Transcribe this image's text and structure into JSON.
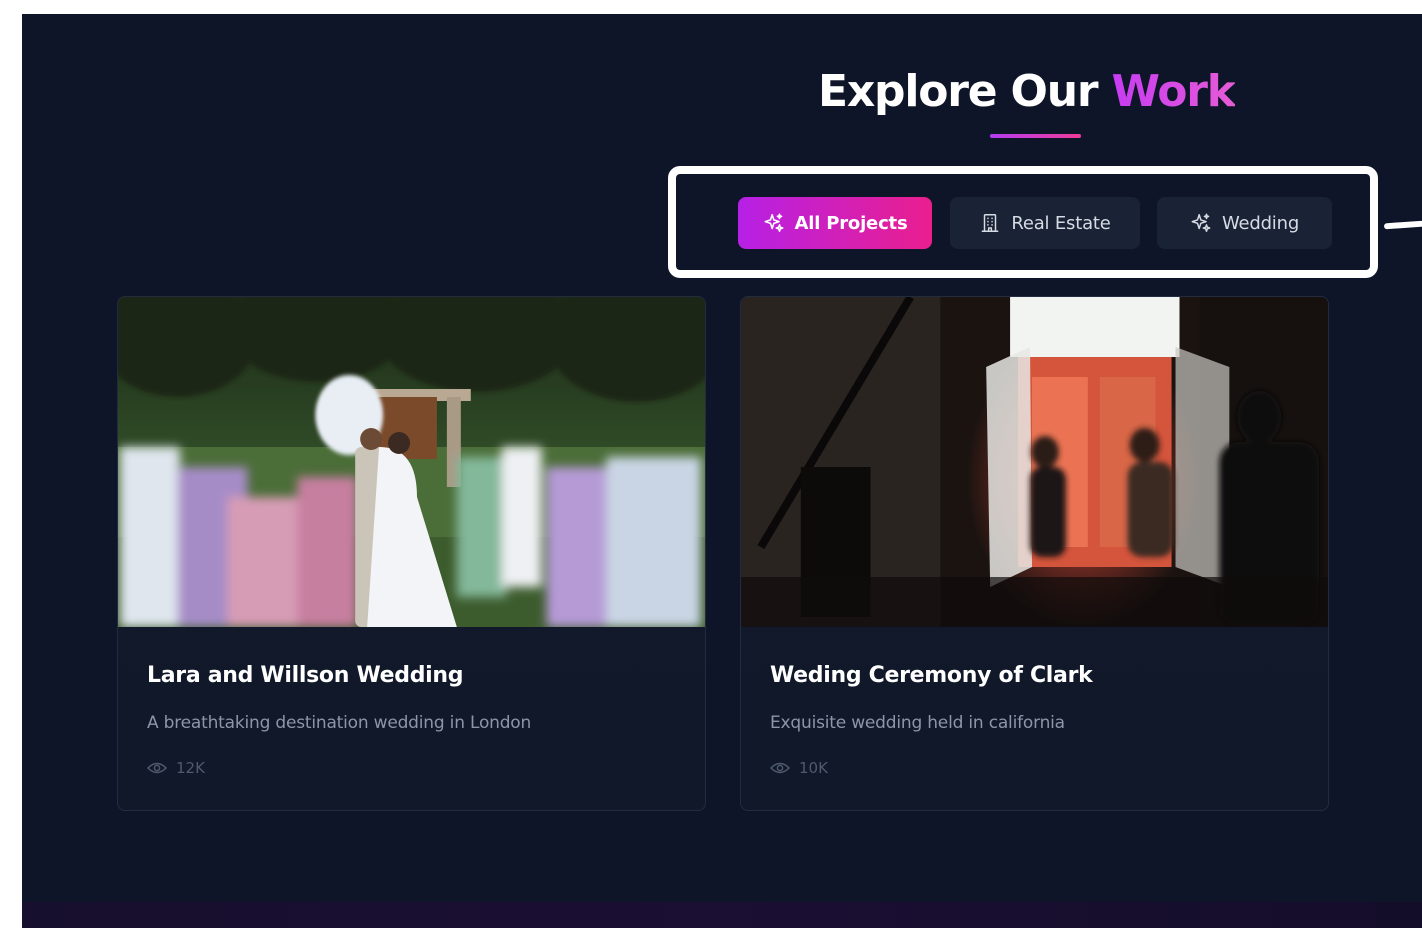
{
  "header": {
    "title_prefix": "Explore Our ",
    "title_accent": "Work"
  },
  "filters": [
    {
      "label": "All Projects",
      "icon": "sparkles-icon",
      "active": true
    },
    {
      "label": "Real Estate",
      "icon": "building-icon",
      "active": false
    },
    {
      "label": "Wedding",
      "icon": "sparkles-icon",
      "active": false
    }
  ],
  "projects": [
    {
      "title": "Lara and Willson Wedding",
      "description": "A breathtaking destination wedding in London",
      "views": "12K",
      "image": "wedding-couple-photo"
    },
    {
      "title": "Weding Ceremony of Clark",
      "description": "Exquisite wedding held in california",
      "views": "10K",
      "image": "film-set-window-photo"
    }
  ],
  "colors": {
    "background": "#0e1528",
    "accent_start": "#b620e6",
    "accent_end": "#ea1f8d",
    "card_bg": "#121a2c"
  }
}
